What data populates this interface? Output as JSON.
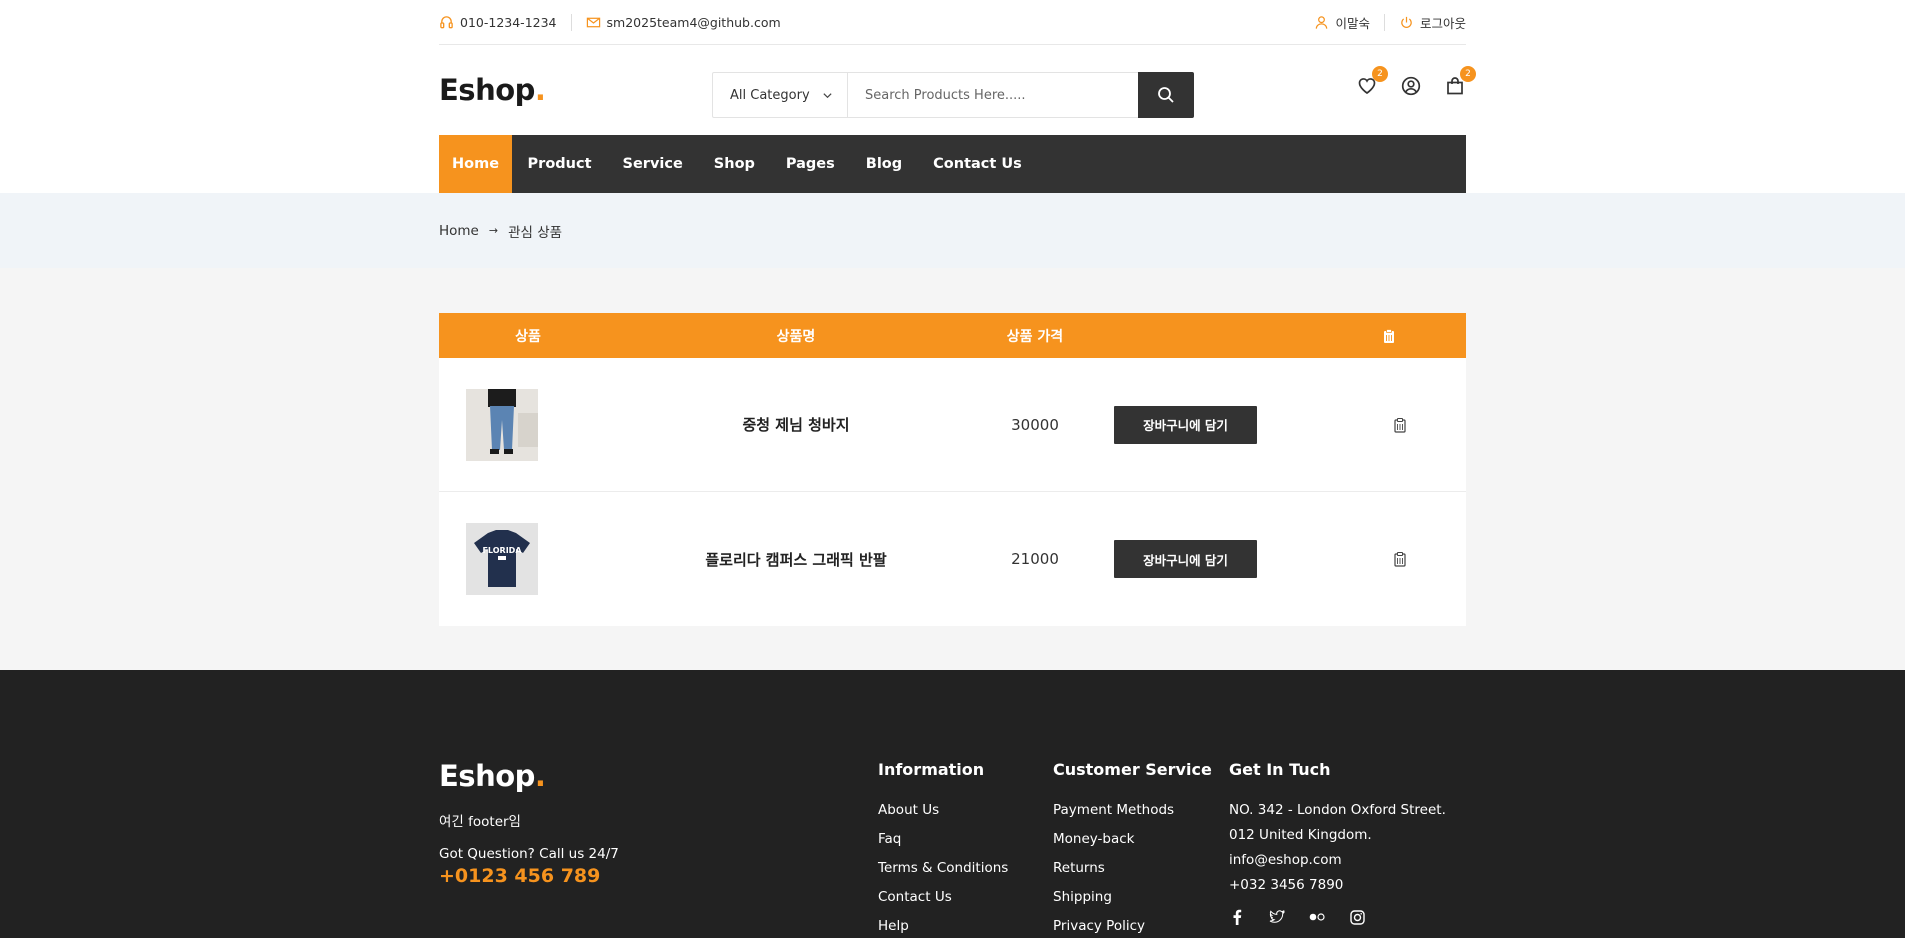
{
  "topbar": {
    "phone": "010-1234-1234",
    "email": "sm2025team4@github.com",
    "user_name": "이말숙",
    "logout": "로그아웃"
  },
  "header": {
    "logo_text": "Eshop",
    "logo_dot": ".",
    "category_select": "All Category",
    "search_placeholder": "Search Products Here.....",
    "wishlist_count": "2",
    "cart_count": "2"
  },
  "nav": {
    "items": [
      "Home",
      "Product",
      "Service",
      "Shop",
      "Pages",
      "Blog",
      "Contact Us"
    ],
    "active": "Home"
  },
  "breadcrumb": {
    "home": "Home",
    "current": "관심 상품"
  },
  "wishlist_table": {
    "headers": {
      "product": "상품",
      "name": "상품명",
      "price": "상품 가격"
    },
    "rows": [
      {
        "name": "중청 제님 청바지",
        "price": "30000",
        "button": "장바구니에 담기",
        "image": "denim-jeans"
      },
      {
        "name": "플로리다 캠퍼스 그래픽 반팔",
        "price": "21000",
        "button": "장바구니에 담기",
        "image": "florida-tshirt"
      }
    ]
  },
  "footer": {
    "logo_text": "Eshop",
    "logo_dot": ".",
    "tagline": "여긴 footer임",
    "question": "Got Question? Call us 24/7",
    "phone": "+0123 456 789",
    "information": {
      "title": "Information",
      "links": [
        "About Us",
        "Faq",
        "Terms & Conditions",
        "Contact Us",
        "Help"
      ]
    },
    "customer_service": {
      "title": "Customer Service",
      "links": [
        "Payment Methods",
        "Money-back",
        "Returns",
        "Shipping",
        "Privacy Policy"
      ]
    },
    "contact": {
      "title": "Get In Tuch",
      "address1": "NO. 342 - London Oxford Street.",
      "address2": "012 United Kingdom.",
      "email": "info@eshop.com",
      "phone": "+032 3456 7890"
    },
    "social_icons": [
      "facebook-icon",
      "twitter-icon",
      "flickr-icon",
      "instagram-icon"
    ]
  },
  "colors": {
    "accent": "#f6931e",
    "dark": "#333333",
    "footer_bg": "#222222"
  }
}
